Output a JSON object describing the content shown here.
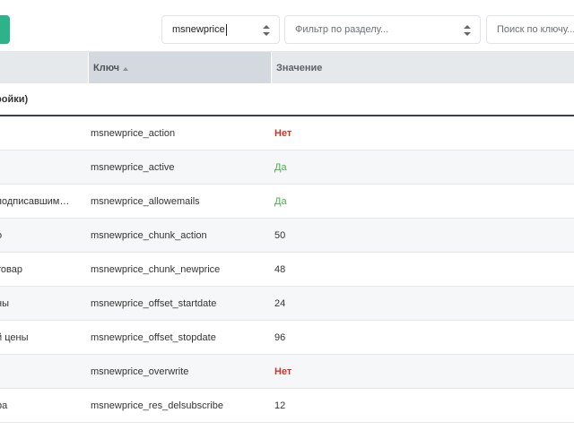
{
  "filters": {
    "namespace_value": "msnewprice",
    "area_placeholder": "Фильтр по разделу...",
    "search_placeholder": "Поиск по ключу..."
  },
  "table": {
    "columns": [
      "",
      "Ключ",
      "Значение"
    ],
    "group_label": "ройки)",
    "rows": [
      {
        "name": "",
        "key": "msnewprice_action",
        "value": "Нет",
        "type": "no"
      },
      {
        "name": "",
        "key": "msnewprice_active",
        "value": "Да",
        "type": "yes"
      },
      {
        "name": "подписавшим…",
        "key": "msnewprice_allowemails",
        "value": "Да",
        "type": "yes"
      },
      {
        "name": "о",
        "key": "msnewprice_chunk_action",
        "value": "50",
        "type": "num"
      },
      {
        "name": "товар",
        "key": "msnewprice_chunk_newprice",
        "value": "48",
        "type": "num"
      },
      {
        "name": "ны",
        "key": "msnewprice_offset_startdate",
        "value": "24",
        "type": "num"
      },
      {
        "name": "й цены",
        "key": "msnewprice_offset_stopdate",
        "value": "96",
        "type": "num"
      },
      {
        "name": "",
        "key": "msnewprice_overwrite",
        "value": "Нет",
        "type": "no"
      },
      {
        "name": "ра",
        "key": "msnewprice_res_delsubscribe",
        "value": "12",
        "type": "num"
      }
    ]
  },
  "colors": {
    "accent": "#2db38a",
    "no": "#c0392b",
    "yes": "#4cae4c",
    "header_bg": "#e6e9ec"
  }
}
